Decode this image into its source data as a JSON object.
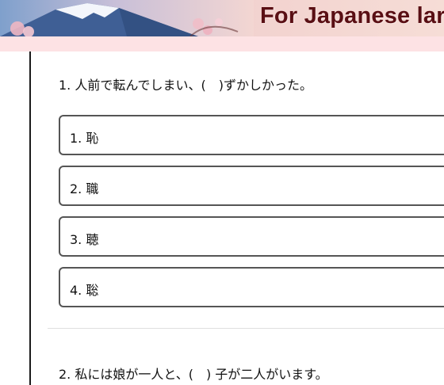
{
  "banner": {
    "title": "For Japanese lar"
  },
  "questions": [
    {
      "text": "1. 人前で転んでしまい、(　)ずかしかった。",
      "options": [
        "1. 恥",
        "2. 職",
        "3. 聴",
        "4. 聡"
      ]
    },
    {
      "text": "2. 私には娘が一人と、(　) 子が二人がいます。"
    }
  ],
  "colors": {
    "title": "#5a0f14",
    "pink_band": "#fde2e4",
    "option_border": "#555555"
  }
}
